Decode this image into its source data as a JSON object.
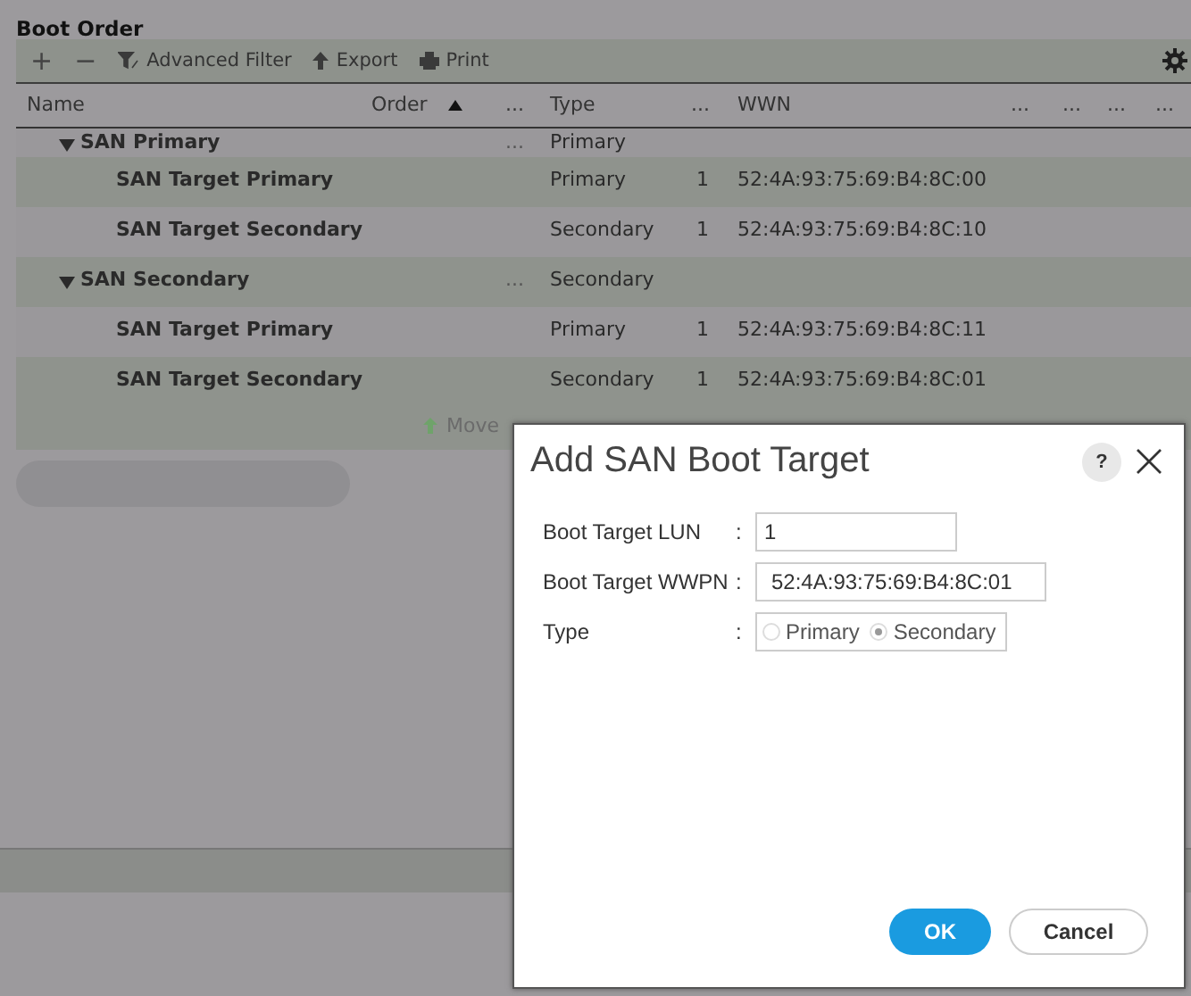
{
  "title": "Boot Order",
  "toolbar": [
    {
      "kind": "plus",
      "label": "+"
    },
    {
      "kind": "minus",
      "label": "−"
    },
    {
      "kind": "filter",
      "label": "Advanced Filter"
    },
    {
      "kind": "export",
      "label": "Export"
    },
    {
      "kind": "print",
      "label": "Print"
    }
  ],
  "table": {
    "columns": [
      {
        "label": "Name",
        "sorted": false
      },
      {
        "label": "Order",
        "sorted": true
      },
      {
        "label": "...",
        "sorted": false
      },
      {
        "label": "Type",
        "sorted": false
      },
      {
        "label": "...",
        "sorted": false
      },
      {
        "label": "WWN",
        "sorted": false
      },
      {
        "label": "...",
        "sorted": false
      },
      {
        "label": "...",
        "sorted": false
      },
      {
        "label": "...",
        "sorted": false
      },
      {
        "label": "...",
        "sorted": false
      }
    ],
    "rows": [
      {
        "kind": "group",
        "expanded": true,
        "name": "SAN Primary",
        "more": "...",
        "type": "Primary"
      },
      {
        "kind": "target",
        "name": "SAN Target Primary",
        "type": "Primary",
        "lun": "1",
        "wwn": "52:4A:93:75:69:B4:8C:00"
      },
      {
        "kind": "target",
        "name": "SAN Target Secondary",
        "type": "Secondary",
        "lun": "1",
        "wwn": "52:4A:93:75:69:B4:8C:10"
      },
      {
        "kind": "group",
        "expanded": true,
        "name": "SAN Secondary",
        "more": "...",
        "type": "Secondary"
      },
      {
        "kind": "target",
        "name": "SAN Target Primary",
        "type": "Primary",
        "lun": "1",
        "wwn": "52:4A:93:75:69:B4:8C:11"
      },
      {
        "kind": "target",
        "name": "SAN Target Secondary",
        "type": "Secondary",
        "lun": "1",
        "wwn": "52:4A:93:75:69:B4:8C:01"
      }
    ]
  },
  "move_button": "Move",
  "dialog": {
    "title": "Add SAN Boot Target",
    "help": "?",
    "fields": [
      {
        "kind": "text",
        "label": "Boot Target LUN",
        "separator": ":",
        "value": "1"
      },
      {
        "kind": "text",
        "label": "Boot Target WWPN",
        "separator": ":",
        "value": "52:4A:93:75:69:B4:8C:01"
      },
      {
        "kind": "radio",
        "label": "Type",
        "separator": ":",
        "options": [
          {
            "label": "Primary",
            "selected": false
          },
          {
            "label": "Secondary",
            "selected": true
          }
        ]
      }
    ],
    "ok": "OK",
    "cancel": "Cancel"
  }
}
